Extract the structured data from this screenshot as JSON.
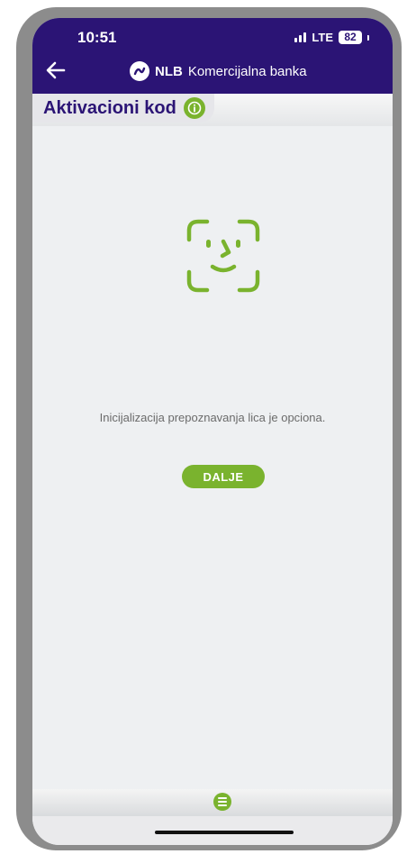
{
  "status_bar": {
    "time": "10:51",
    "network": "LTE",
    "battery": "82"
  },
  "header": {
    "back_icon": "arrow-left-icon",
    "brand_bold": "NLB",
    "brand_rest": "Komercijalna banka"
  },
  "title": {
    "text": "Aktivacioni kod",
    "info_icon": "info-icon"
  },
  "content": {
    "face_icon": "face-id-icon",
    "message": "Inicijalizacija prepoznavanja lica je opciona.",
    "next_label": "DALJE"
  },
  "bottom": {
    "menu_icon": "menu-icon"
  },
  "colors": {
    "primary": "#2b1475",
    "accent": "#7ab32e",
    "background": "#eef0f2"
  }
}
